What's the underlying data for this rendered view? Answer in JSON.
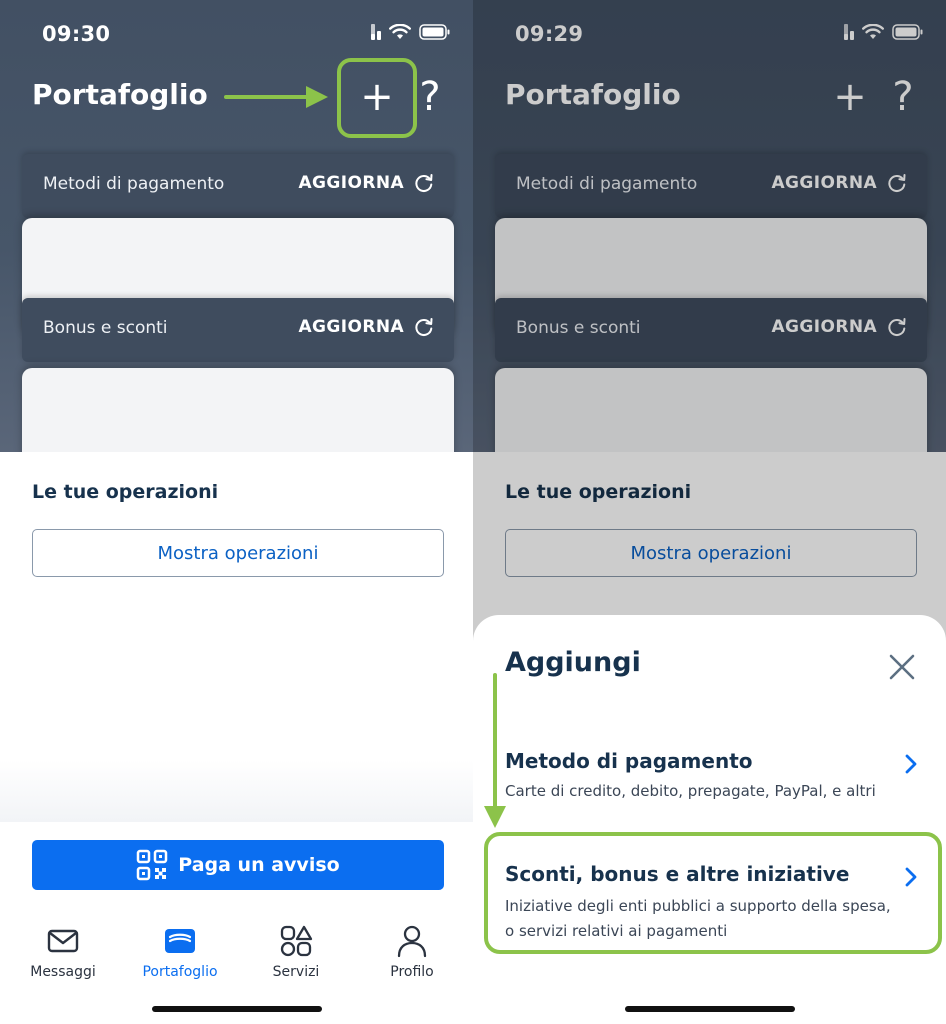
{
  "left": {
    "status": {
      "time": "09:30"
    },
    "header": {
      "title": "Portafoglio",
      "add_label": "+",
      "help_label": "?"
    },
    "cards": [
      {
        "label": "Metodi di pagamento",
        "action": "AGGIORNA"
      },
      {
        "label": "Bonus e sconti",
        "action": "AGGIORNA"
      }
    ],
    "operations": {
      "title": "Le tue operazioni",
      "button": "Mostra operazioni"
    },
    "pay_button": "Paga un avviso",
    "tabs": [
      {
        "label": "Messaggi",
        "icon": "mail-icon"
      },
      {
        "label": "Portafoglio",
        "icon": "wallet-icon",
        "active": true
      },
      {
        "label": "Servizi",
        "icon": "services-icon"
      },
      {
        "label": "Profilo",
        "icon": "profile-icon"
      }
    ]
  },
  "right": {
    "status": {
      "time": "09:29"
    },
    "header": {
      "title": "Portafoglio",
      "add_label": "+",
      "help_label": "?"
    },
    "cards": [
      {
        "label": "Metodi di pagamento",
        "action": "AGGIORNA"
      },
      {
        "label": "Bonus e sconti",
        "action": "AGGIORNA"
      }
    ],
    "operations": {
      "title": "Le tue operazioni",
      "button": "Mostra operazioni"
    },
    "sheet": {
      "title": "Aggiungi",
      "options": [
        {
          "title": "Metodo di pagamento",
          "subtitle": "Carte di credito, debito, prepagate, PayPal, e altri"
        },
        {
          "title": "Sconti, bonus e altre iniziative",
          "subtitle_line1": "Iniziative degli enti pubblici a supporto della spesa,",
          "subtitle_line2": "o servizi relativi ai pagamenti"
        }
      ]
    }
  },
  "colors": {
    "header_bg": "#475669",
    "primary_blue": "#0b6ef0",
    "text_dark": "#17324d",
    "highlight_green": "#8cc34a"
  }
}
